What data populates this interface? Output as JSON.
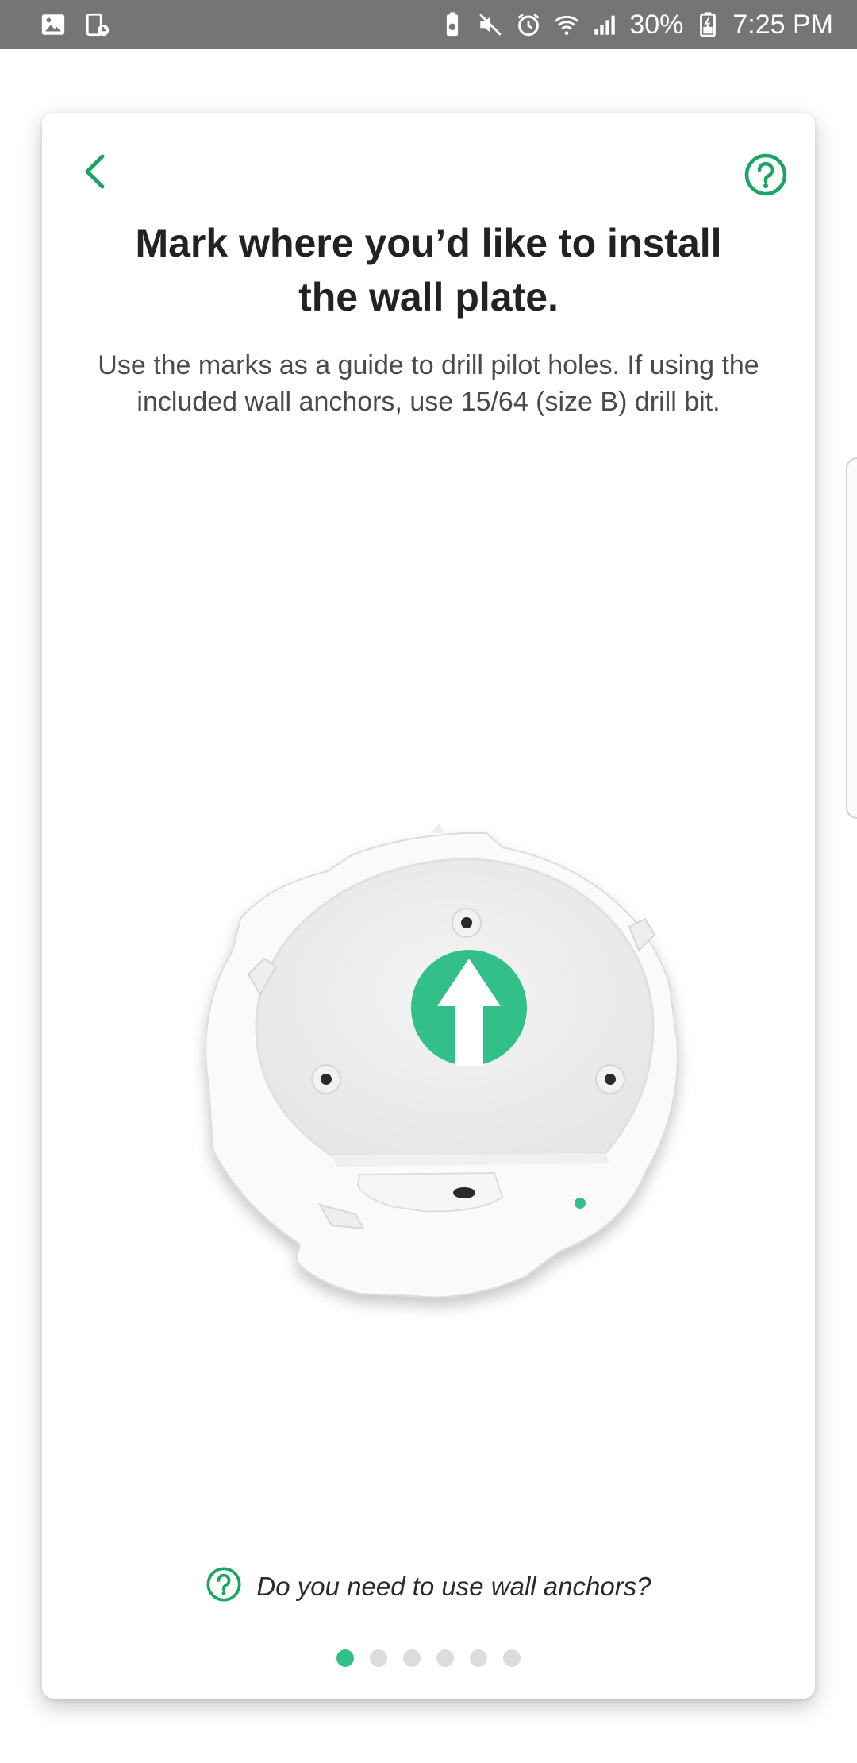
{
  "status_bar": {
    "battery": "30%",
    "time": "7:25 PM",
    "icons_left": [
      "gallery-icon",
      "screen-recorder-icon"
    ],
    "icons_right": [
      "battery-saver-icon",
      "mute-icon",
      "alarm-icon",
      "wifi-icon",
      "signal-icon",
      "battery-icon"
    ]
  },
  "page": {
    "title_line1": "Mark where you’d like to install",
    "title_line2": "the wall plate.",
    "subtitle_line1": "Use the marks as a guide to drill pilot holes. If using the",
    "subtitle_line2": "included wall anchors, use 15/64 (size B) drill bit.",
    "anchor_question": "Do you need to use wall anchors?"
  },
  "pager": {
    "total": 6,
    "current": 1
  },
  "colors": {
    "accent": "#1ba462",
    "arrow": "#33bf8a",
    "status_bar": "#757575"
  }
}
